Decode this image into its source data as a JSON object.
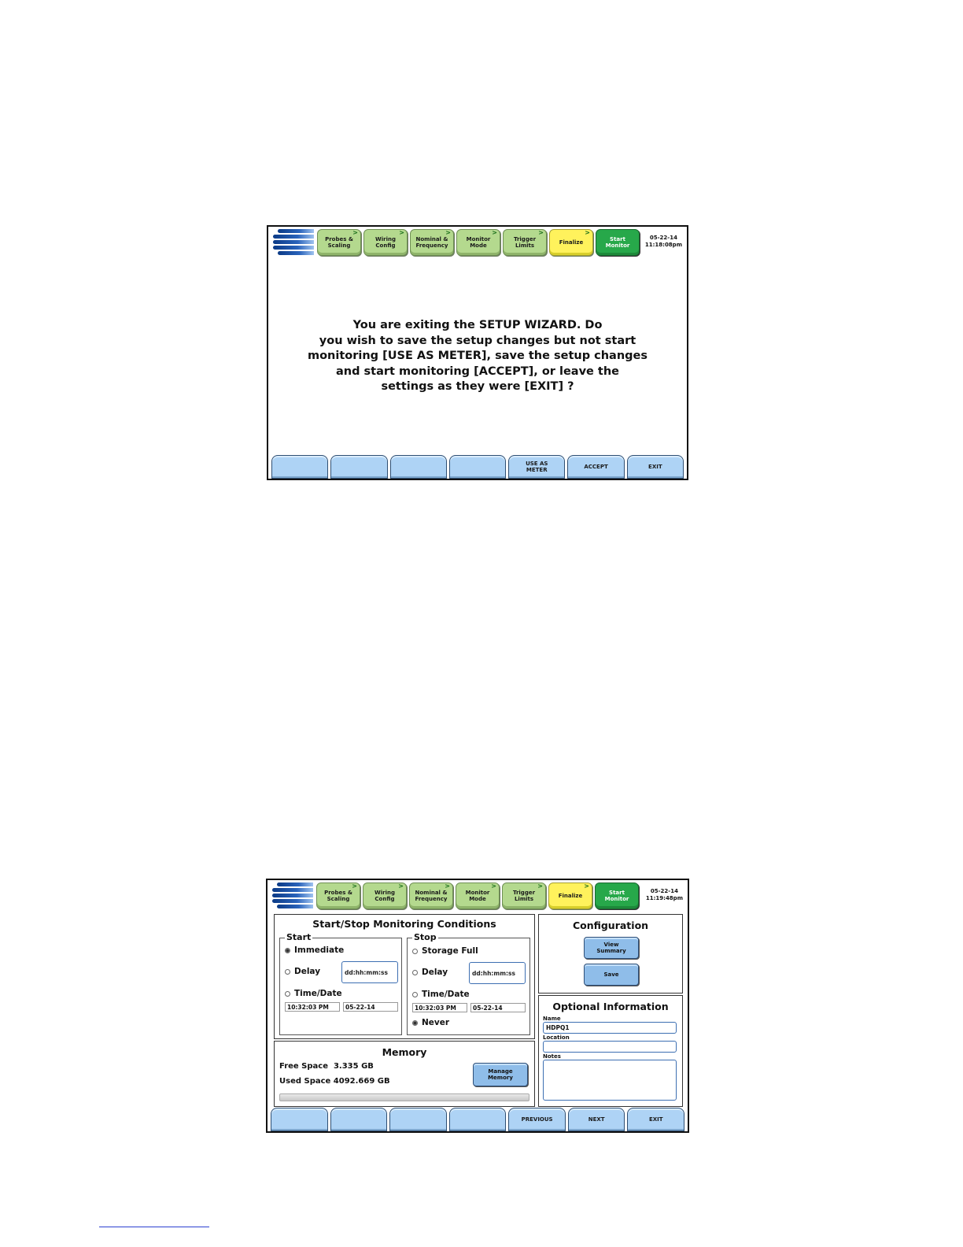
{
  "wizard_tabs": [
    {
      "label": "Probes & Scaling"
    },
    {
      "label": "Wiring Config"
    },
    {
      "label": "Nominal & Frequency"
    },
    {
      "label": "Monitor Mode"
    },
    {
      "label": "Trigger Limits"
    },
    {
      "label": "Finalize"
    },
    {
      "label": "Start Monitor"
    }
  ],
  "screen1": {
    "date": "05-22-14",
    "time": "11:18:08pm",
    "message_lines": [
      "You are exiting the SETUP WIZARD.  Do",
      "you wish to save the setup changes but not start",
      "monitoring [USE AS METER], save the setup changes",
      "and start monitoring [ACCEPT], or leave the",
      "settings as they were [EXIT] ?"
    ],
    "footer": {
      "use_as_meter": "USE AS METER",
      "accept": "ACCEPT",
      "exit": "EXIT"
    }
  },
  "screen2": {
    "date": "05-22-14",
    "time": "11:19:48pm",
    "conditions": {
      "title": "Start/Stop Monitoring Conditions",
      "start": {
        "label": "Start",
        "immediate": "Immediate",
        "delay": "Delay",
        "delay_placeholder": "dd:hh:mm:ss",
        "time_date": "Time/Date",
        "time_value": "10:32:03 PM",
        "date_value": "05-22-14"
      },
      "stop": {
        "label": "Stop",
        "storage_full": "Storage Full",
        "delay": "Delay",
        "delay_placeholder": "dd:hh:mm:ss",
        "time_date": "Time/Date",
        "time_value": "10:32:03 PM",
        "date_value": "05-22-14",
        "never": "Never"
      }
    },
    "memory": {
      "title": "Memory",
      "free_label": "Free Space",
      "free_value": "3.335 GB",
      "used_label": "Used Space",
      "used_value": "4092.669 GB",
      "manage_button": "Manage Memory"
    },
    "configuration": {
      "title": "Configuration",
      "view_summary": "View Summary",
      "save": "Save"
    },
    "optional": {
      "title": "Optional Information",
      "name_label": "Name",
      "name_value": "HDPQ1",
      "location_label": "Location",
      "location_value": "",
      "notes_label": "Notes",
      "notes_value": ""
    },
    "footer": {
      "previous": "PREVIOUS",
      "next": "NEXT",
      "exit": "EXIT"
    }
  }
}
